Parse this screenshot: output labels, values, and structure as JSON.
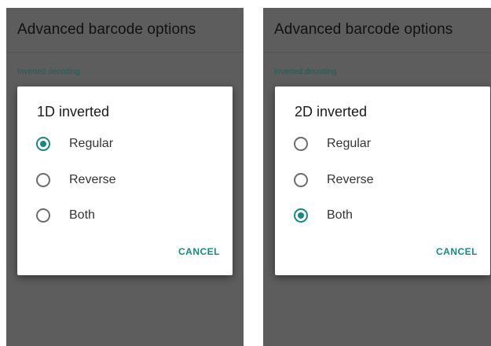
{
  "screens": [
    {
      "app_title": "Advanced barcode options",
      "section_label": "Inverted decoding",
      "dialog": {
        "title": "1D inverted",
        "options": [
          {
            "label": "Regular",
            "checked": true
          },
          {
            "label": "Reverse",
            "checked": false
          },
          {
            "label": "Both",
            "checked": false
          }
        ],
        "cancel_label": "CANCEL"
      }
    },
    {
      "app_title": "Advanced barcode options",
      "section_label": "Inverted decoding",
      "dialog": {
        "title": "2D inverted",
        "options": [
          {
            "label": "Regular",
            "checked": false
          },
          {
            "label": "Reverse",
            "checked": false
          },
          {
            "label": "Both",
            "checked": true
          }
        ],
        "cancel_label": "CANCEL"
      }
    }
  ],
  "colors": {
    "accent": "#168a7e",
    "scrim": "#5d5d5d",
    "dialog_bg": "#ffffff"
  }
}
